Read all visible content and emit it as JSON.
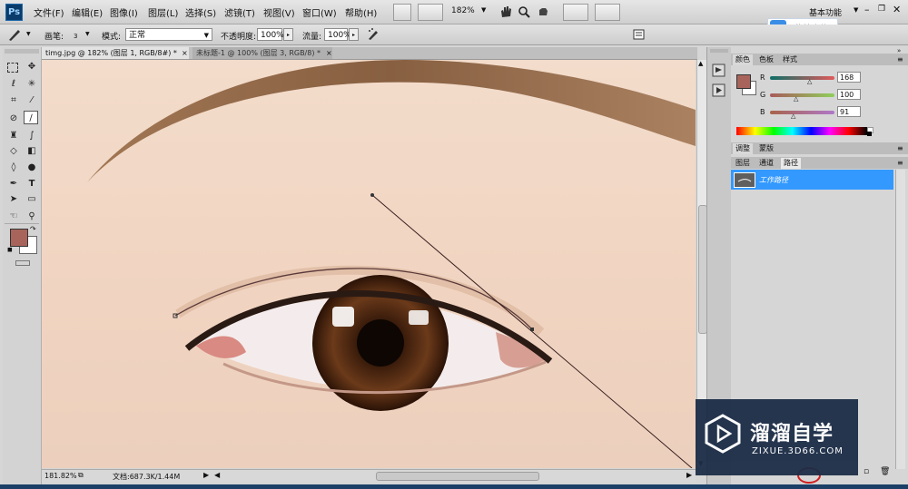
{
  "app": {
    "logo": "Ps"
  },
  "menu": {
    "items": [
      "文件(F)",
      "编辑(E)",
      "图像(I)",
      "图层(L)",
      "选择(S)",
      "滤镜(T)",
      "视图(V)",
      "窗口(W)",
      "帮助(H)"
    ],
    "zoom": "182%",
    "workspace": "基本功能"
  },
  "cloud_upload": {
    "label": "拖拽上传"
  },
  "options": {
    "brush_label": "画笔:",
    "brush_size": "3",
    "mode_label": "模式:",
    "mode_value": "正常",
    "opacity_label": "不透明度:",
    "opacity_value": "100%",
    "flow_label": "流量:",
    "flow_value": "100%"
  },
  "tabs": [
    {
      "label": "timg.jpg @ 182% (图层 1, RGB/8#) *",
      "active": true
    },
    {
      "label": "未标题-1 @ 100% (图层 3, RGB/8) *",
      "active": false
    }
  ],
  "status": {
    "zoom": "181.82%",
    "doc": "文档:687.3K/1.44M"
  },
  "color_panel": {
    "tabs": [
      "颜色",
      "色板",
      "样式"
    ],
    "channels": [
      {
        "name": "R",
        "value": "168",
        "pos": 0.66
      },
      {
        "name": "G",
        "value": "100",
        "pos": 0.39
      },
      {
        "name": "B",
        "value": "91",
        "pos": 0.36
      }
    ],
    "foreground": "#a8645b",
    "background": "#ffffff"
  },
  "adjust_panel": {
    "tabs": [
      "调整",
      "蒙版"
    ]
  },
  "layers_panel": {
    "tabs": [
      "图层",
      "通道",
      "路径"
    ],
    "paths": [
      "工作路径"
    ]
  },
  "watermark": {
    "title": "溜溜自学",
    "url": "ZIXUE.3D66.COM"
  },
  "colors": {
    "selection": "#3399ff",
    "path": "#5a3a3a"
  }
}
